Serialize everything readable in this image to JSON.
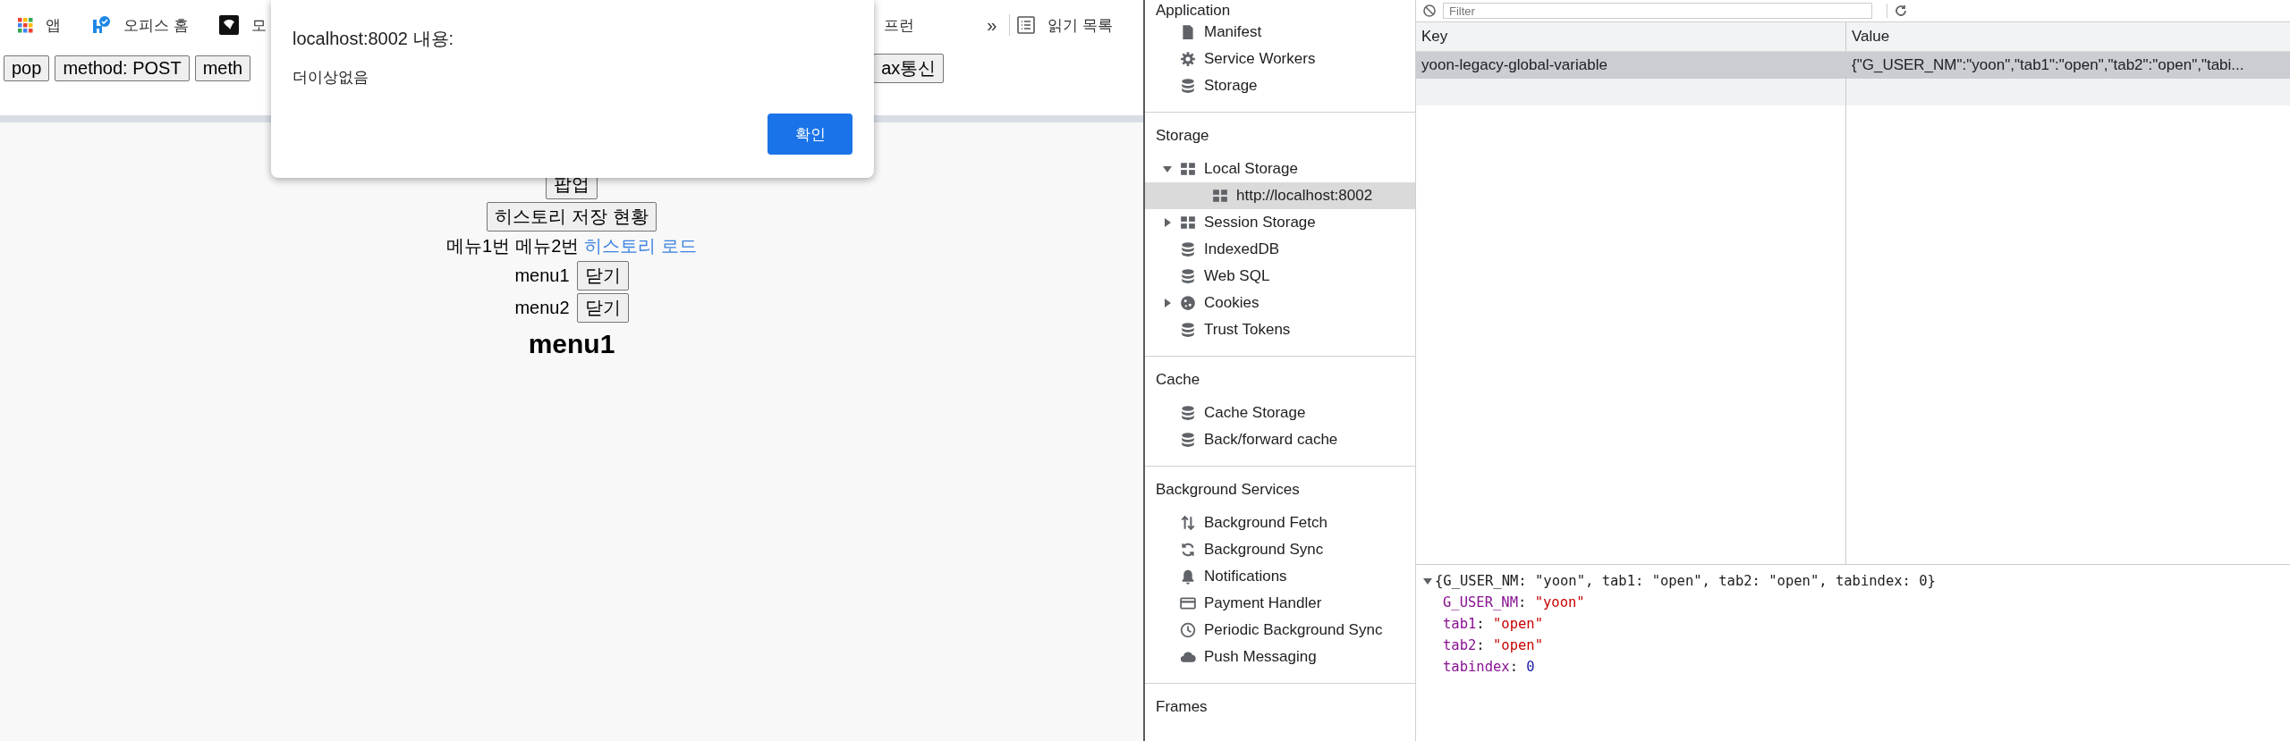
{
  "bookmarks_bar": {
    "items": [
      {
        "label": "앱"
      },
      {
        "label": "오피스 홈"
      },
      {
        "label": "모"
      }
    ],
    "hidden_item": "프런",
    "overflow": "»",
    "reading_list": "읽기 목록"
  },
  "page_buttons": {
    "left": [
      "pop",
      "method: POST",
      "meth"
    ],
    "right": [
      "ax통신"
    ]
  },
  "page": {
    "popup_button": "팝업",
    "history_button": "히스토리 저장 현황",
    "links": [
      {
        "label": "메뉴1번",
        "kind": "text"
      },
      {
        "label": "메뉴2번",
        "kind": "text"
      },
      {
        "label": "히스토리 로드",
        "kind": "link"
      }
    ],
    "menus": [
      {
        "label": "menu1",
        "close": "닫기"
      },
      {
        "label": "menu2",
        "close": "닫기"
      }
    ],
    "heading": "menu1"
  },
  "dialog": {
    "title": "localhost:8002 내용:",
    "message": "더이상없음",
    "ok": "확인"
  },
  "devtools": {
    "filter": {
      "placeholder": "Filter"
    },
    "sidebar": [
      {
        "title": "Application",
        "items": [
          {
            "label": "Manifest",
            "selected": false
          },
          {
            "label": "Service Workers",
            "selected": false
          },
          {
            "label": "Storage",
            "selected": false
          }
        ]
      },
      {
        "title": "Storage",
        "items": [
          {
            "label": "Local Storage",
            "selected": false,
            "expanded": true,
            "children": [
              {
                "label": "http://localhost:8002",
                "selected": true
              }
            ]
          },
          {
            "label": "Session Storage",
            "selected": false,
            "expanded": false
          },
          {
            "label": "IndexedDB",
            "selected": false
          },
          {
            "label": "Web SQL",
            "selected": false
          },
          {
            "label": "Cookies",
            "selected": false,
            "expanded": false
          },
          {
            "label": "Trust Tokens",
            "selected": false
          }
        ]
      },
      {
        "title": "Cache",
        "items": [
          {
            "label": "Cache Storage",
            "selected": false
          },
          {
            "label": "Back/forward cache",
            "selected": false
          }
        ]
      },
      {
        "title": "Background Services",
        "items": [
          {
            "label": "Background Fetch",
            "selected": false
          },
          {
            "label": "Background Sync",
            "selected": false
          },
          {
            "label": "Notifications",
            "selected": false
          },
          {
            "label": "Payment Handler",
            "selected": false
          },
          {
            "label": "Periodic Background Sync",
            "selected": false
          },
          {
            "label": "Push Messaging",
            "selected": false
          }
        ]
      },
      {
        "title": "Frames"
      }
    ],
    "table": {
      "columns": [
        "Key",
        "Value"
      ],
      "rows": [
        {
          "key": "yoon-legacy-global-variable",
          "value": "{\"G_USER_NM\":\"yoon\",\"tab1\":\"open\",\"tab2\":\"open\",\"tabi...",
          "selected": true
        }
      ]
    },
    "preview": {
      "summary": "{G_USER_NM: \"yoon\", tab1: \"open\", tab2: \"open\", tabindex: 0}",
      "expanded": true,
      "properties": [
        {
          "name": "G_USER_NM:",
          "value": "\"yoon\"",
          "kind": "string"
        },
        {
          "name": "tab1:",
          "value": "\"open\"",
          "kind": "string"
        },
        {
          "name": "tab2:",
          "value": "\"open\"",
          "kind": "string"
        },
        {
          "name": "tabindex:",
          "value": "0",
          "kind": "number"
        }
      ]
    }
  }
}
